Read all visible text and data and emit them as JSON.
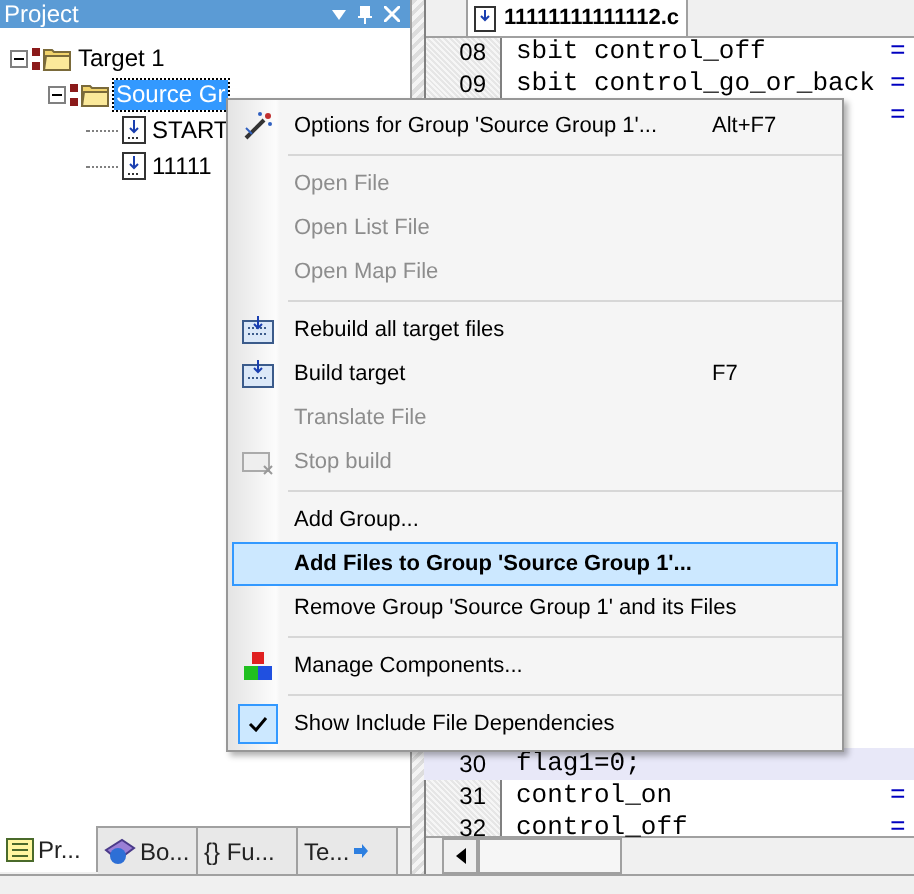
{
  "panel": {
    "title": "Project"
  },
  "tree": [
    {
      "label": "Target 1",
      "expanded": true,
      "selected": false,
      "children": [
        {
          "label": "Source Gr",
          "expanded": true,
          "selected": true,
          "children": [
            {
              "label": "START",
              "selected": false
            },
            {
              "label": "11111",
              "selected": false
            }
          ]
        }
      ]
    }
  ],
  "panel_tabs": [
    {
      "label": "Pr...",
      "selected": true
    },
    {
      "label": "Bo...",
      "selected": false
    },
    {
      "label": "{} Fu...",
      "selected": false
    },
    {
      "label": "Te...",
      "selected": false
    }
  ],
  "editor": {
    "tab": "11111111111112.c",
    "top_lines": [
      {
        "number": "08",
        "code": "sbit control_off",
        "value": "="
      },
      {
        "number": "09",
        "code": "sbit control_go_or_back",
        "value": "="
      },
      {
        "value": "="
      }
    ],
    "bottom_lines": [
      {
        "number": "30",
        "code": "flag1=0;",
        "current": true
      },
      {
        "number": "31",
        "code": "control_on",
        "value": "=",
        "current": false
      },
      {
        "number": "32",
        "code": "control_off",
        "value": "=",
        "current": false
      }
    ]
  },
  "context_menu": [
    {
      "kind": "item",
      "label": "Options for Group 'Source Group 1'...",
      "shortcut": "Alt+F7",
      "disabled": false,
      "selected": false,
      "checked": false
    },
    {
      "kind": "separator"
    },
    {
      "kind": "item",
      "label": "Open File",
      "disabled": true,
      "selected": false,
      "checked": false
    },
    {
      "kind": "item",
      "label": "Open List File",
      "disabled": true,
      "selected": false,
      "checked": false
    },
    {
      "kind": "item",
      "label": "Open Map File",
      "disabled": true,
      "selected": false,
      "checked": false
    },
    {
      "kind": "separator"
    },
    {
      "kind": "item",
      "label": "Rebuild all target files",
      "disabled": false,
      "selected": false,
      "checked": false
    },
    {
      "kind": "item",
      "label": "Build target",
      "shortcut": "F7",
      "disabled": false,
      "selected": false,
      "checked": false
    },
    {
      "kind": "item",
      "label": "Translate File",
      "disabled": true,
      "selected": false,
      "checked": false
    },
    {
      "kind": "item",
      "label": "Stop build",
      "disabled": true,
      "selected": false,
      "checked": false
    },
    {
      "kind": "separator"
    },
    {
      "kind": "item",
      "label": "Add Group...",
      "disabled": false,
      "selected": false,
      "checked": false
    },
    {
      "kind": "item",
      "label": "Add Files to Group 'Source Group 1'...",
      "disabled": false,
      "selected": true,
      "checked": false
    },
    {
      "kind": "item",
      "label": "Remove Group 'Source Group 1' and its Files",
      "disabled": false,
      "selected": false,
      "checked": false
    },
    {
      "kind": "separator"
    },
    {
      "kind": "item",
      "label": "Manage Components...",
      "disabled": false,
      "selected": false,
      "checked": false
    },
    {
      "kind": "separator"
    },
    {
      "kind": "item",
      "label": "Show Include File Dependencies",
      "disabled": false,
      "selected": false,
      "checked": true
    }
  ]
}
